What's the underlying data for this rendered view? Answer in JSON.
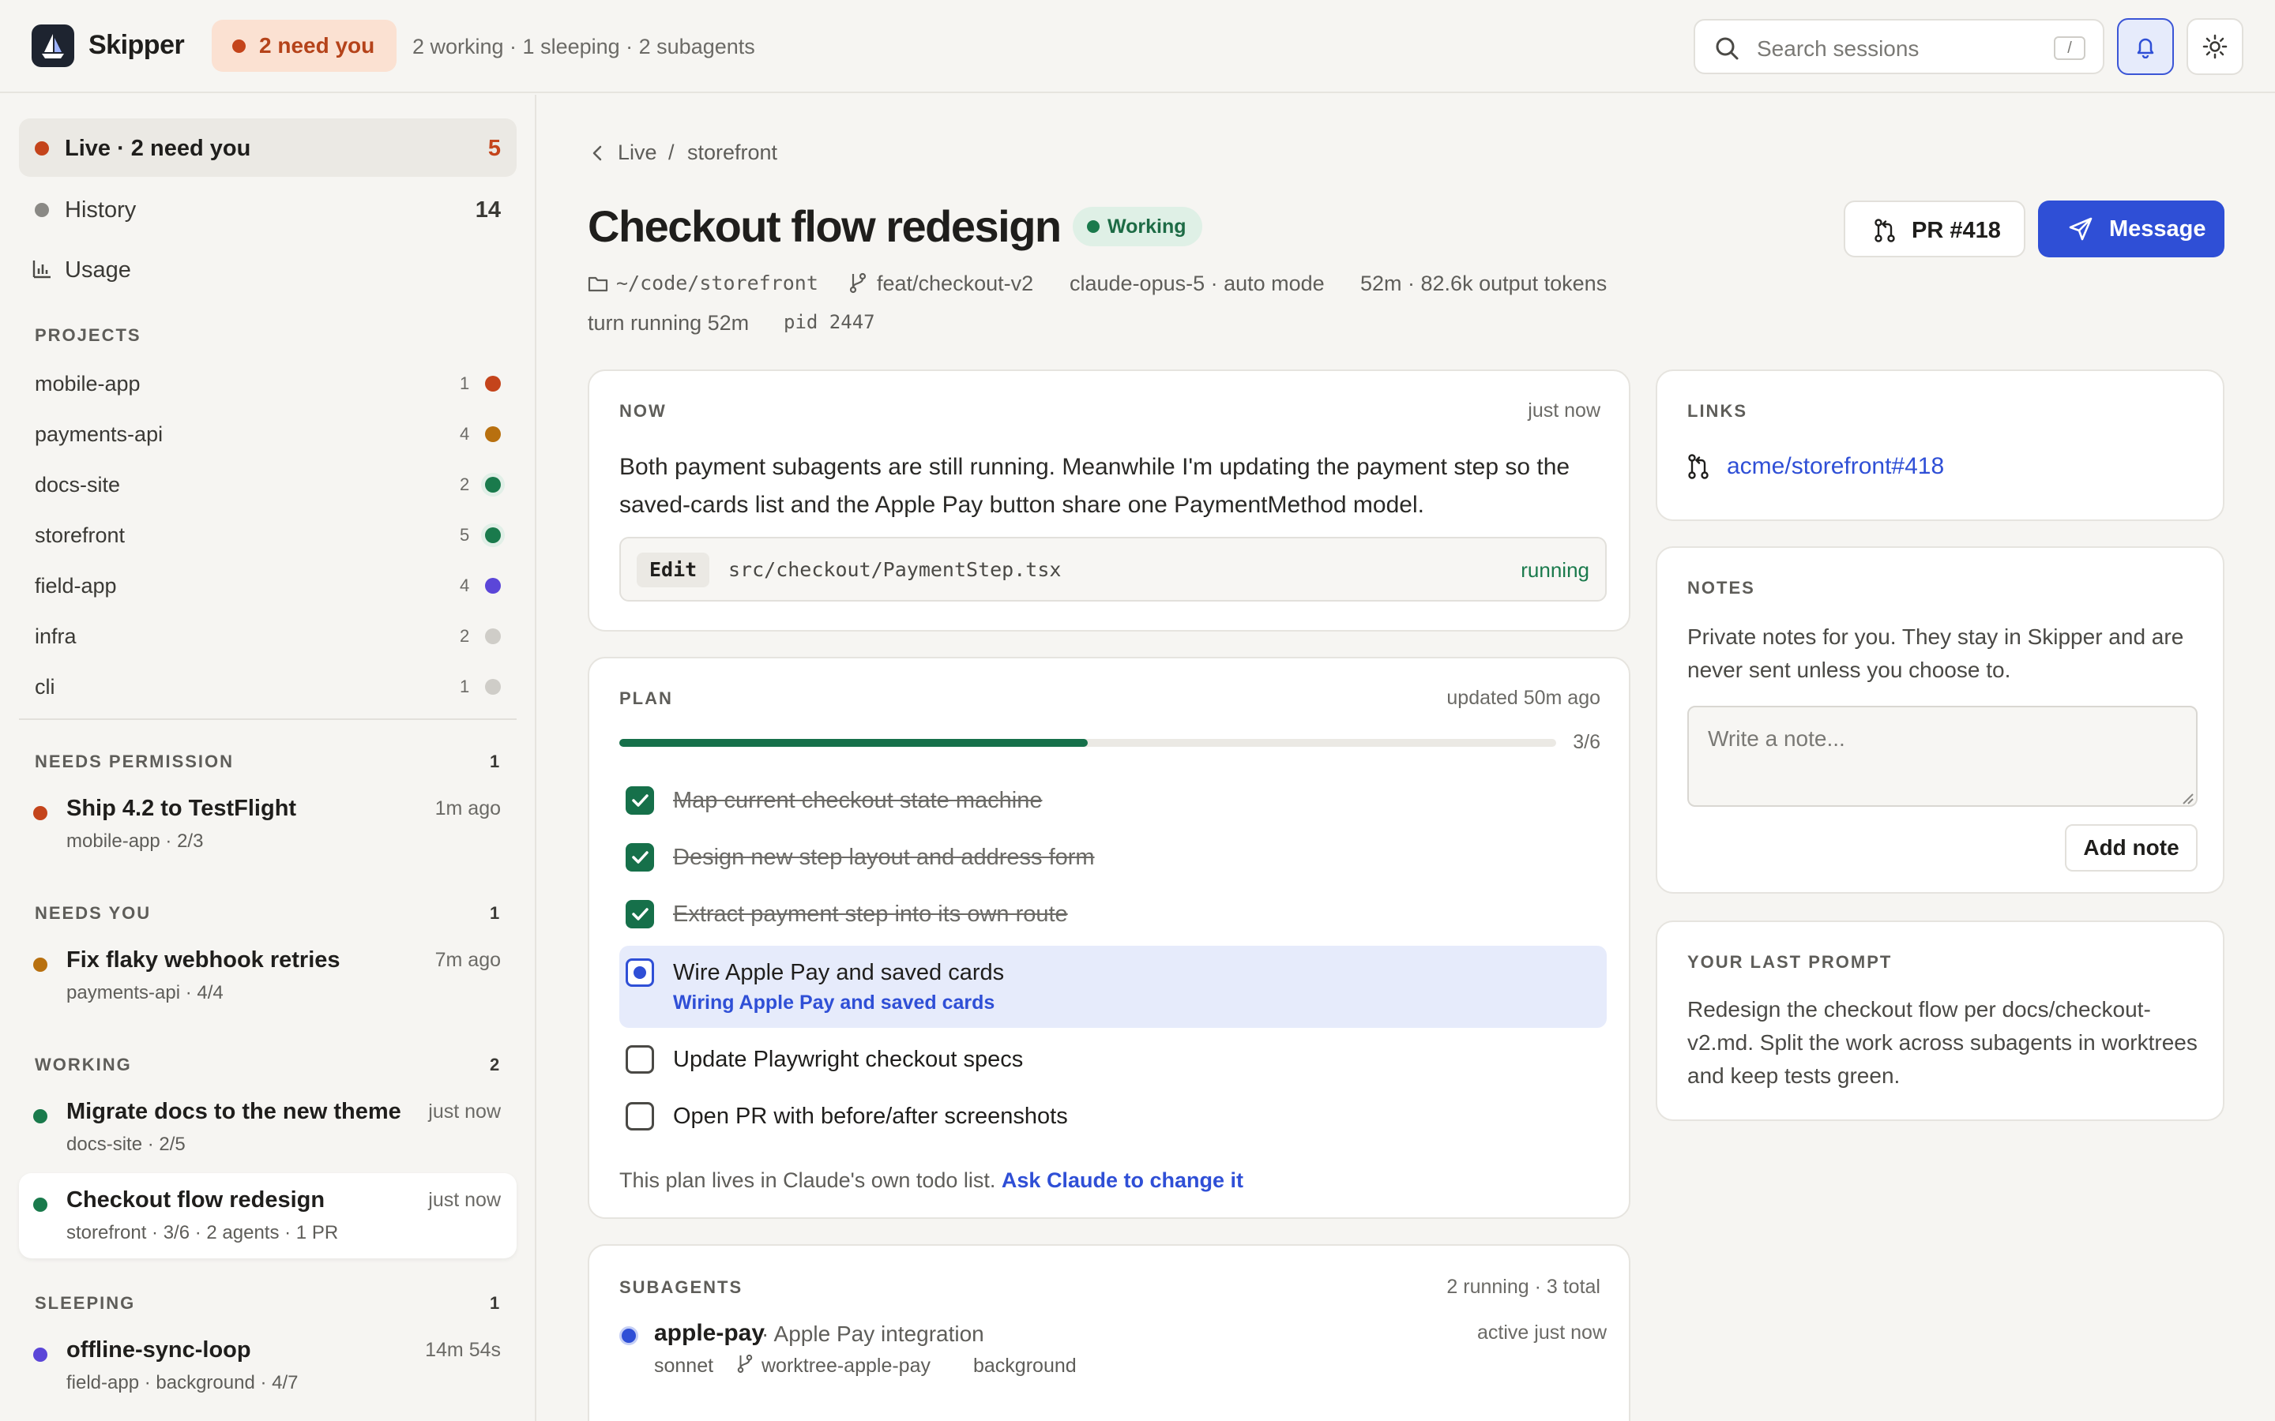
{
  "app": {
    "name": "Skipper"
  },
  "topbar": {
    "need_pill": "2 need you",
    "status": "2 working · 1 sleeping · 2 subagents",
    "search_placeholder": "Search sessions",
    "search_shortcut": "/"
  },
  "sidebar": {
    "nav": [
      {
        "label": "Live · 2 need you",
        "count": "5"
      },
      {
        "label": "History",
        "count": "14"
      },
      {
        "label": "Usage",
        "count": ""
      }
    ],
    "projects_heading": "PROJECTS",
    "projects": [
      {
        "name": "mobile-app",
        "count": "1",
        "color": "#c4441b"
      },
      {
        "name": "payments-api",
        "count": "4",
        "color": "#b8700f"
      },
      {
        "name": "docs-site",
        "count": "2",
        "color": "#1a7a4c"
      },
      {
        "name": "storefront",
        "count": "5",
        "color": "#1a7a4c"
      },
      {
        "name": "field-app",
        "count": "4",
        "color": "#5b46d8"
      },
      {
        "name": "infra",
        "count": "2",
        "color": "#cfcdc8"
      },
      {
        "name": "cli",
        "count": "1",
        "color": "#cfcdc8"
      }
    ],
    "groups": [
      {
        "heading": "NEEDS PERMISSION",
        "count": "1",
        "sessions": [
          {
            "title": "Ship 4.2 to TestFlight",
            "time": "1m ago",
            "meta": "mobile-app  · 2/3",
            "color": "#c4441b"
          }
        ]
      },
      {
        "heading": "NEEDS YOU",
        "count": "1",
        "sessions": [
          {
            "title": "Fix flaky webhook retries",
            "time": "7m ago",
            "meta": "payments-api  · 4/4",
            "color": "#b8700f"
          }
        ]
      },
      {
        "heading": "WORKING",
        "count": "2",
        "sessions": [
          {
            "title": "Migrate docs to the new theme",
            "time": "just now",
            "meta": "docs-site  · 2/5",
            "color": "#1a7a4c"
          },
          {
            "title": "Checkout flow redesign",
            "time": "just now",
            "meta": "storefront  · 3/6  · 2 agents  · 1 PR",
            "color": "#1a7a4c"
          }
        ]
      },
      {
        "heading": "SLEEPING",
        "count": "1",
        "sessions": [
          {
            "title": "offline-sync-loop",
            "time": "14m 54s",
            "meta": "field-app  · background  · 4/7",
            "color": "#5b46d8"
          }
        ]
      }
    ]
  },
  "main": {
    "breadcrumb": {
      "back": "Live",
      "sep": "/",
      "current": "storefront"
    },
    "title": "Checkout flow redesign",
    "status": "Working",
    "pr_button": "PR #418",
    "message_button": "Message",
    "meta": {
      "path": "~/code/storefront",
      "branch": "feat/checkout-v2",
      "model": "claude-opus-5 · auto mode",
      "usage": "52m · 82.6k output tokens",
      "turn": "turn running 52m",
      "pid": "pid 2447"
    },
    "now": {
      "label": "NOW",
      "time": "just now",
      "text": "Both payment subagents are still running. Meanwhile I'm updating the payment step so the saved-cards list and the Apple Pay button share one PaymentMethod model.",
      "tool": "Edit",
      "file": "src/checkout/PaymentStep.tsx",
      "state": "running"
    },
    "plan": {
      "label": "PLAN",
      "updated": "updated  50m ago",
      "progress_text": "3/6",
      "progress": 0.5,
      "tasks": [
        {
          "text": "Map current checkout state machine",
          "state": "done"
        },
        {
          "text": "Design new step layout and address form",
          "state": "done"
        },
        {
          "text": "Extract payment step into its own route",
          "state": "done"
        },
        {
          "text": "Wire Apple Pay and saved cards",
          "state": "running",
          "sub": "Wiring Apple Pay and saved cards"
        },
        {
          "text": "Update Playwright checkout specs",
          "state": "todo"
        },
        {
          "text": "Open PR with before/after screenshots",
          "state": "todo"
        }
      ],
      "footer": "This plan lives in Claude's own todo list.",
      "footer_link": "Ask Claude to change it"
    },
    "subagents": {
      "label": "SUBAGENTS",
      "summary": "2 running · 3 total",
      "items": [
        {
          "name": "apple-pay",
          "desc": " · Apple Pay integration",
          "model": "sonnet",
          "worktree": "worktree-apple-pay",
          "mode": "background",
          "activity": "active just now"
        }
      ]
    }
  },
  "right": {
    "links": {
      "label": "LINKS",
      "item": "acme/storefront#418"
    },
    "notes": {
      "label": "NOTES",
      "desc": "Private notes for you. They stay in Skipper and are never sent unless you choose to.",
      "placeholder": "Write a note...",
      "button": "Add note"
    },
    "prompt": {
      "label": "YOUR LAST PROMPT",
      "text": "Redesign the checkout flow per docs/checkout-v2.md. Split the work across subagents in worktrees and keep tests green."
    }
  }
}
